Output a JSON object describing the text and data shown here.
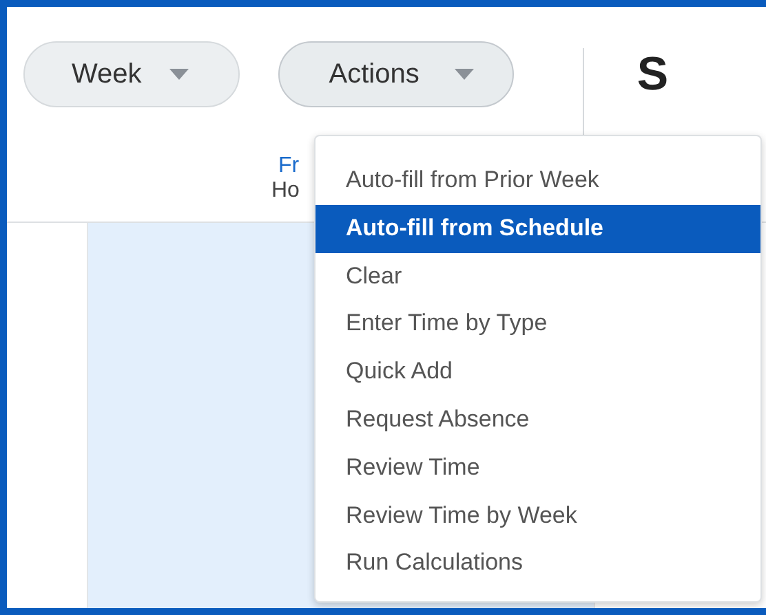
{
  "toolbar": {
    "buttons": [
      {
        "label": "Week"
      },
      {
        "label": "Actions",
        "expanded": true
      }
    ],
    "heading": "S"
  },
  "day_header": {
    "link": "Fr",
    "hours": "Ho"
  },
  "actions_menu": {
    "items": [
      {
        "label": "Auto-fill from Prior Week",
        "selected": false
      },
      {
        "label": "Auto-fill from Schedule",
        "selected": true
      },
      {
        "label": "Clear",
        "selected": false
      },
      {
        "label": "Enter Time by Type",
        "selected": false
      },
      {
        "label": "Quick Add",
        "selected": false
      },
      {
        "label": "Request Absence",
        "selected": false
      },
      {
        "label": "Review Time",
        "selected": false
      },
      {
        "label": "Review Time by Week",
        "selected": false
      },
      {
        "label": "Run Calculations",
        "selected": false
      }
    ]
  }
}
